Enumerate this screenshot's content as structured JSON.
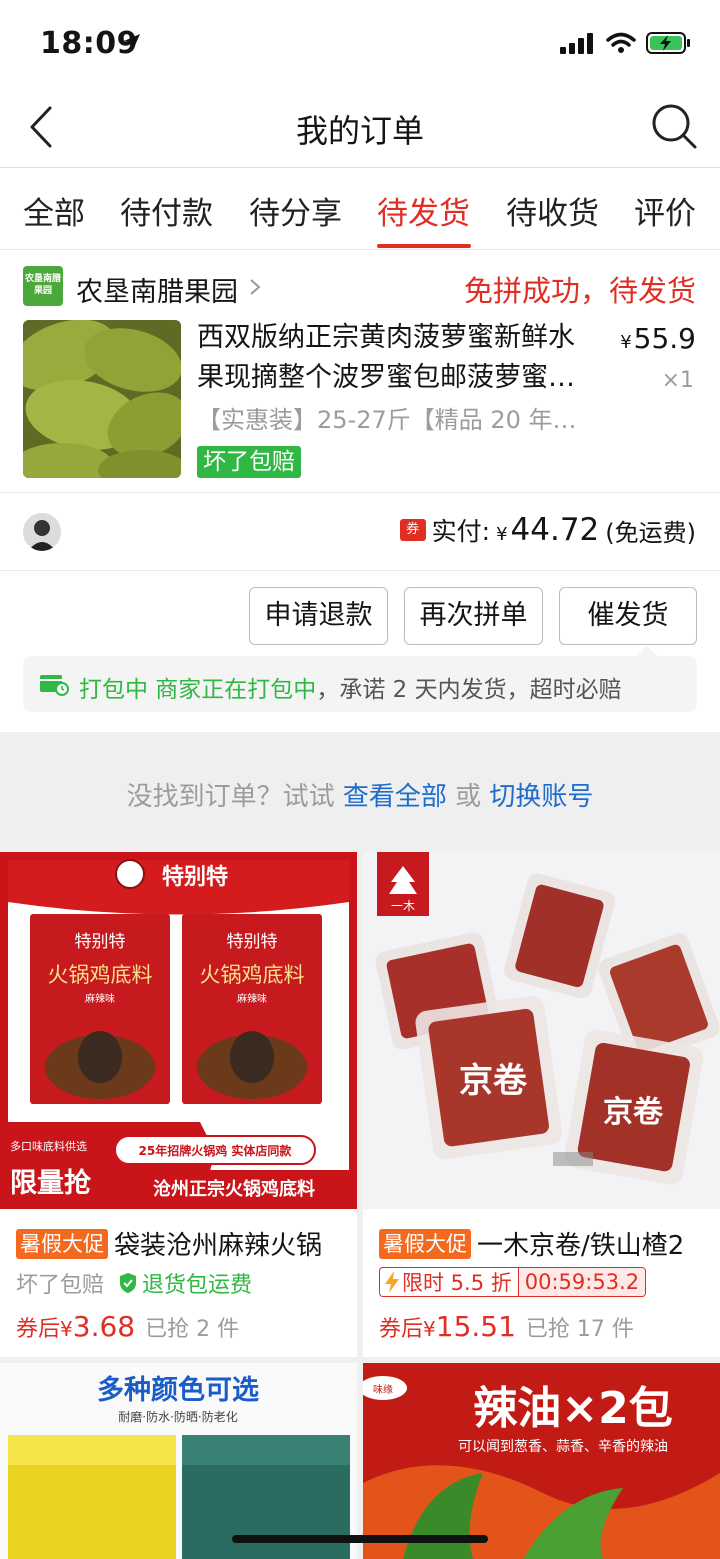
{
  "status_bar": {
    "time": "18:09"
  },
  "nav": {
    "title": "我的订单"
  },
  "tabs": [
    {
      "label": "全部",
      "active": false
    },
    {
      "label": "待付款",
      "active": false
    },
    {
      "label": "待分享",
      "active": false
    },
    {
      "label": "待发货",
      "active": true
    },
    {
      "label": "待收货",
      "active": false
    },
    {
      "label": "评价",
      "active": false
    }
  ],
  "order": {
    "shop_logo_text": "农垦南腊果园",
    "shop_name": "农垦南腊果园",
    "status": "免拼成功，待发货",
    "product": {
      "title": "西双版纳正宗黄肉菠萝蜜新鲜水果现摘整个波罗蜜包邮菠萝蜜…",
      "currency": "¥",
      "price": "55.9",
      "quantity": "×1",
      "spec": "【实惠装】25-27斤【精品 20 年…",
      "badge": "坏了包赔"
    },
    "coupon_icon": "券",
    "pay_label": "实付:",
    "pay_currency": "¥",
    "pay_amount": "44.72",
    "pay_note": "(免运费)",
    "buttons": {
      "refund": "申请退款",
      "regroup": "再次拼单",
      "urge": "催发货"
    },
    "notice": {
      "status": "打包中 商家正在打包中",
      "text": "，承诺 2 天内发货，超时必赔"
    }
  },
  "hint": {
    "prefix": "没找到订单？试试 ",
    "view_all": "查看全部",
    "or": " 或 ",
    "switch": "切换账号"
  },
  "recommend": [
    {
      "promo": "暑假大促",
      "title": "袋装沧州麻辣火锅",
      "sub1": "坏了包赔",
      "sub2": "退货包运费",
      "price_label": "券后",
      "currency": "¥",
      "price": "3.68",
      "sold": "已抢 2 件",
      "img": {
        "brand": "特别特",
        "pack_title": "火锅鸡底料",
        "pack_sub": "麻辣味",
        "left_tag": "多口味底料供选",
        "left_big": "限量抢",
        "right_tag": "25年招牌火锅鸡 实体店同款",
        "right_big": "沧州正宗火锅鸡底料"
      }
    },
    {
      "promo": "暑假大促",
      "title": "一木京卷/铁山楂2",
      "flash_label": "限时 5.5 折",
      "countdown": "00:59:53.2",
      "price_label": "券后",
      "currency": "¥",
      "price": "15.51",
      "sold": "已抢 17 件",
      "img": {
        "brand": "一木",
        "item_text": "京卷"
      }
    },
    {
      "img": {
        "headline": "多种颜色可选",
        "sub": "耐磨·防水·防晒·防老化"
      }
    },
    {
      "img": {
        "headline": "辣油×2包",
        "sub": "可以闻到葱香、蒜香、辛香的辣油",
        "logo": "味缘"
      }
    }
  ]
}
